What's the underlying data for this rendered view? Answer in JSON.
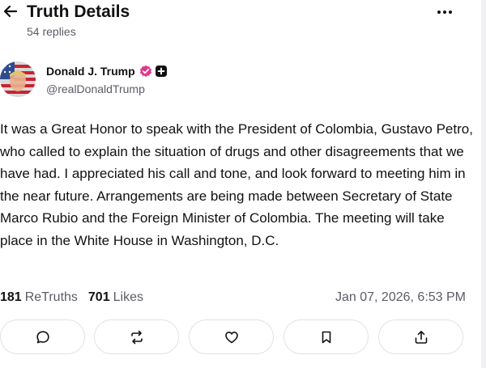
{
  "header": {
    "title": "Truth Details",
    "replies": "54 replies"
  },
  "author": {
    "name": "Donald J. Trump",
    "handle": "@realDonaldTrump"
  },
  "post": {
    "text": "It was a Great Honor to speak with the President of Colombia, Gustavo Petro, who called to explain the situation of drugs and other disagreements that we have had. I appreciated his call and tone, and look forward to meeting him in the near future. Arrangements are being made between Secretary of State Marco Rubio and the Foreign Minister of Colombia. The meeting will take place in the White House in Washington, D.C."
  },
  "stats": {
    "retruths_count": "181",
    "retruths_label": "ReTruths",
    "likes_count": "701",
    "likes_label": "Likes",
    "timestamp": "Jan 07, 2026, 6:53 PM"
  },
  "actions": [
    {
      "icon": "reply-icon"
    },
    {
      "icon": "retruth-icon"
    },
    {
      "icon": "like-icon"
    },
    {
      "icon": "bookmark-icon"
    },
    {
      "icon": "share-icon"
    }
  ],
  "colors": {
    "verified": "#e2378c",
    "text": "#111111",
    "muted": "#5b5b66",
    "border": "#e2e2e6"
  }
}
